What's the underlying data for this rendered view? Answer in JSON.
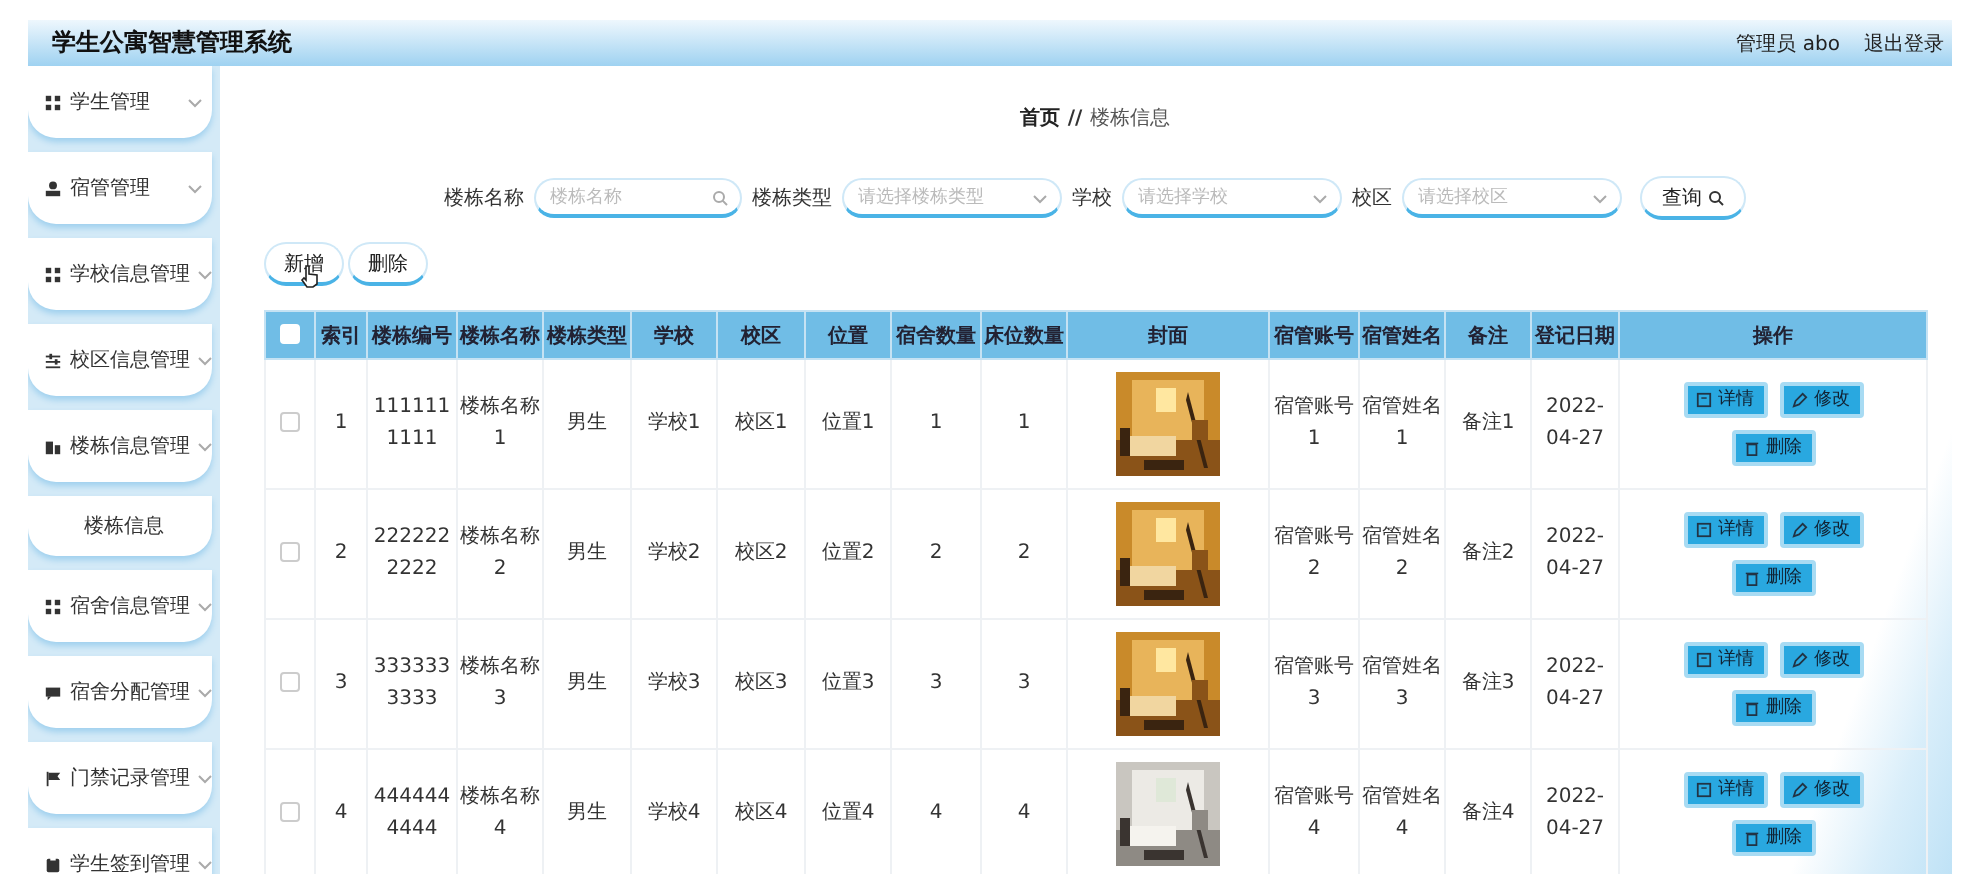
{
  "header": {
    "title": "学生公寓智慧管理系统",
    "user": "管理员 abo",
    "logout": "退出登录"
  },
  "sidebar": {
    "items": [
      {
        "label": "学生管理"
      },
      {
        "label": "宿管管理"
      },
      {
        "label": "学校信息管理"
      },
      {
        "label": "校区信息管理"
      },
      {
        "label": "楼栋信息管理",
        "children": [
          {
            "label": "楼栋信息"
          }
        ]
      },
      {
        "label": "宿舍信息管理"
      },
      {
        "label": "宿舍分配管理"
      },
      {
        "label": "门禁记录管理"
      },
      {
        "label": "学生签到管理"
      }
    ]
  },
  "breadcrumb": {
    "items": [
      "首页",
      "楼栋信息"
    ],
    "separator": "//"
  },
  "search": {
    "fields": [
      {
        "label": "楼栋名称",
        "placeholder": "楼栋名称",
        "kind": "input"
      },
      {
        "label": "楼栋类型",
        "placeholder": "请选择楼栋类型",
        "kind": "select"
      },
      {
        "label": "学校",
        "placeholder": "请选择学校",
        "kind": "select"
      },
      {
        "label": "校区",
        "placeholder": "请选择校区",
        "kind": "select"
      }
    ],
    "button": "查询"
  },
  "actions": [
    "新增",
    "删除"
  ],
  "table": {
    "select_all": false,
    "columns": [
      {
        "label": "索引",
        "kind": "text"
      },
      {
        "label": "楼栋编号",
        "kind": "text"
      },
      {
        "label": "楼栋名称",
        "kind": "text"
      },
      {
        "label": "楼栋类型",
        "kind": "text"
      },
      {
        "label": "学校",
        "kind": "text"
      },
      {
        "label": "校区",
        "kind": "text"
      },
      {
        "label": "位置",
        "kind": "text"
      },
      {
        "label": "宿舍数量",
        "kind": "text"
      },
      {
        "label": "床位数量",
        "kind": "text"
      },
      {
        "label": "封面",
        "kind": "picture"
      },
      {
        "label": "宿管账号",
        "kind": "text"
      },
      {
        "label": "宿管姓名",
        "kind": "text"
      },
      {
        "label": "备注",
        "kind": "text"
      },
      {
        "label": "登记日期",
        "kind": "text"
      },
      {
        "label": "操作",
        "kind": "actions"
      }
    ],
    "rows": [
      {
        "checked": false,
        "cells": [
          "1",
          "1111111111",
          "楼栋名称1",
          "男生",
          "学校1",
          "校区1",
          "位置1",
          "1",
          "1",
          {
            "kind": "picture"
          },
          "宿管账号1",
          "宿管姓名1",
          "备注1",
          "2022-04-27",
          [
            "详情",
            "修改",
            "删除"
          ]
        ]
      },
      {
        "checked": false,
        "cells": [
          "2",
          "2222222222",
          "楼栋名称2",
          "男生",
          "学校2",
          "校区2",
          "位置2",
          "2",
          "2",
          {
            "kind": "picture"
          },
          "宿管账号2",
          "宿管姓名2",
          "备注2",
          "2022-04-27",
          [
            "详情",
            "修改",
            "删除"
          ]
        ]
      },
      {
        "checked": false,
        "cells": [
          "3",
          "3333333333",
          "楼栋名称3",
          "男生",
          "学校3",
          "校区3",
          "位置3",
          "3",
          "3",
          {
            "kind": "picture"
          },
          "宿管账号3",
          "宿管姓名3",
          "备注3",
          "2022-04-27",
          [
            "详情",
            "修改",
            "删除"
          ]
        ]
      },
      {
        "checked": false,
        "cells": [
          "4",
          "4444444444",
          "楼栋名称4",
          "男生",
          "学校4",
          "校区4",
          "位置4",
          "4",
          "4",
          {
            "kind": "picture"
          },
          "宿管账号4",
          "宿管姓名4",
          "备注4",
          "2022-04-27",
          [
            "详情",
            "修改",
            "删除"
          ]
        ]
      }
    ]
  }
}
